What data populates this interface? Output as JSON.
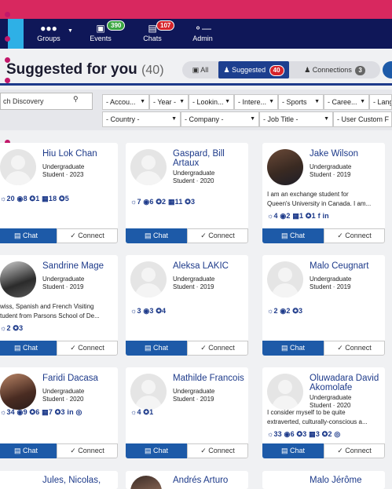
{
  "nav": {
    "groups": "Groups",
    "events": "Events",
    "events_badge": "390",
    "chats": "Chats",
    "chats_badge": "107",
    "admin": "Admin"
  },
  "header": {
    "title": "Suggested for you",
    "count": "(40)",
    "tab_all": "All",
    "tab_suggested": "Suggested",
    "suggested_badge": "40",
    "tab_connections": "Connections",
    "connections_badge": "3"
  },
  "filters": {
    "search_text": "ch Discovery",
    "account": "- Accou...",
    "year": "- Year -",
    "looking": "- Lookin...",
    "interests": "- Intere...",
    "sports": "- Sports",
    "career": "- Caree...",
    "language": "- Lang",
    "country": "- Country -",
    "company": "- Company -",
    "job_title": "- Job Title -",
    "user_custom": "- User Custom F"
  },
  "buttons": {
    "chat": "Chat",
    "connect": "Connect"
  },
  "cards": [
    {
      "name": "Hiu Lok Chan",
      "meta1": "Undergraduate",
      "meta2": "Student · 2023",
      "bio1": "",
      "bio2": "",
      "stats": "☼20 ◉8 ✪1 ▦18 ✪5"
    },
    {
      "name": "Gaspard, Bill Artaux",
      "meta1": "Undergraduate",
      "meta2": "Student · 2020",
      "bio1": "",
      "bio2": "",
      "stats": "☼7 ◉6 ✪2 ▦11 ✪3"
    },
    {
      "name": "Jake Wilson",
      "meta1": "Undergraduate",
      "meta2": "Student · 2019",
      "bio1": "I am an exchange student for",
      "bio2": "Queen's University in Canada. I am...",
      "stats": "☼4 ◉2 ▦1 ✪1 f in"
    },
    {
      "name": "Sandrine Mage",
      "meta1": "Undergraduate",
      "meta2": "Student · 2019",
      "bio1": "wiss, Spanish and French Visiting",
      "bio2": "tudent from Parsons School of De...",
      "stats": "☼2 ✪3"
    },
    {
      "name": "Aleksa LAKIC",
      "meta1": "Undergraduate",
      "meta2": "Student · 2019",
      "bio1": "",
      "bio2": "",
      "stats": "☼3 ◉3 ✪4"
    },
    {
      "name": "Malo Ceugnart",
      "meta1": "Undergraduate",
      "meta2": "Student · 2019",
      "bio1": "",
      "bio2": "",
      "stats": "☼2 ◉2 ✪3"
    },
    {
      "name": "Faridi Dacasa",
      "meta1": "Undergraduate",
      "meta2": "Student · 2020",
      "bio1": "",
      "bio2": "",
      "stats": "☼34 ◉9 ✪6 ▦7 ✪3 in ◎"
    },
    {
      "name": "Mathilde Francois",
      "meta1": "Undergraduate",
      "meta2": "Student · 2019",
      "bio1": "",
      "bio2": "",
      "stats": "☼4 ✪1"
    },
    {
      "name": "Oluwadara David Akomolafe",
      "meta1": "Undergraduate",
      "meta2": "Student · 2020",
      "bio1": "I consider myself to be quite",
      "bio2": "extraverted, culturally-conscious a...",
      "stats": "☼33 ◉6 ✪3 ▦3 ✪2 ◎"
    },
    {
      "name": "Jules, Nicolas,",
      "meta1": "",
      "meta2": "",
      "bio1": "",
      "bio2": "",
      "stats": ""
    },
    {
      "name": "Andrés Arturo",
      "meta1": "",
      "meta2": "",
      "bio1": "",
      "bio2": "",
      "stats": ""
    },
    {
      "name": "Malo Jérôme",
      "meta1": "",
      "meta2": "",
      "bio1": "",
      "bio2": "",
      "stats": ""
    }
  ],
  "colors": {
    "top_bar": "#d8285f",
    "nav_bg": "#0f1758",
    "accent": "#1d5aa8",
    "name_color": "#1d3a8a",
    "badge_red": "#d6242b"
  }
}
